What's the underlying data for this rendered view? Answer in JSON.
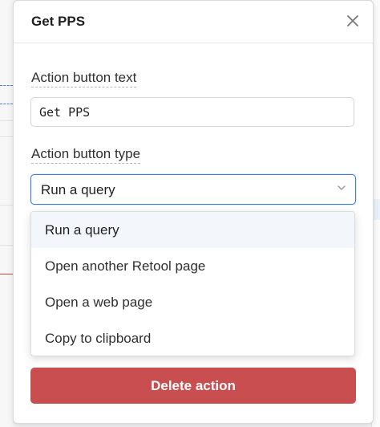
{
  "panel": {
    "title": "Get PPS",
    "close_icon": "close-icon"
  },
  "action_text": {
    "label": "Action button text",
    "value": "Get PPS"
  },
  "action_type": {
    "label": "Action button type",
    "selected": "Run a query",
    "options": [
      "Run a query",
      "Open another Retool page",
      "Open a web page",
      "Copy to clipboard"
    ]
  },
  "delete_button": {
    "label": "Delete action",
    "color": "#c94e4f"
  },
  "colors": {
    "accent": "#3d7bd6",
    "danger": "#c94e4f"
  }
}
